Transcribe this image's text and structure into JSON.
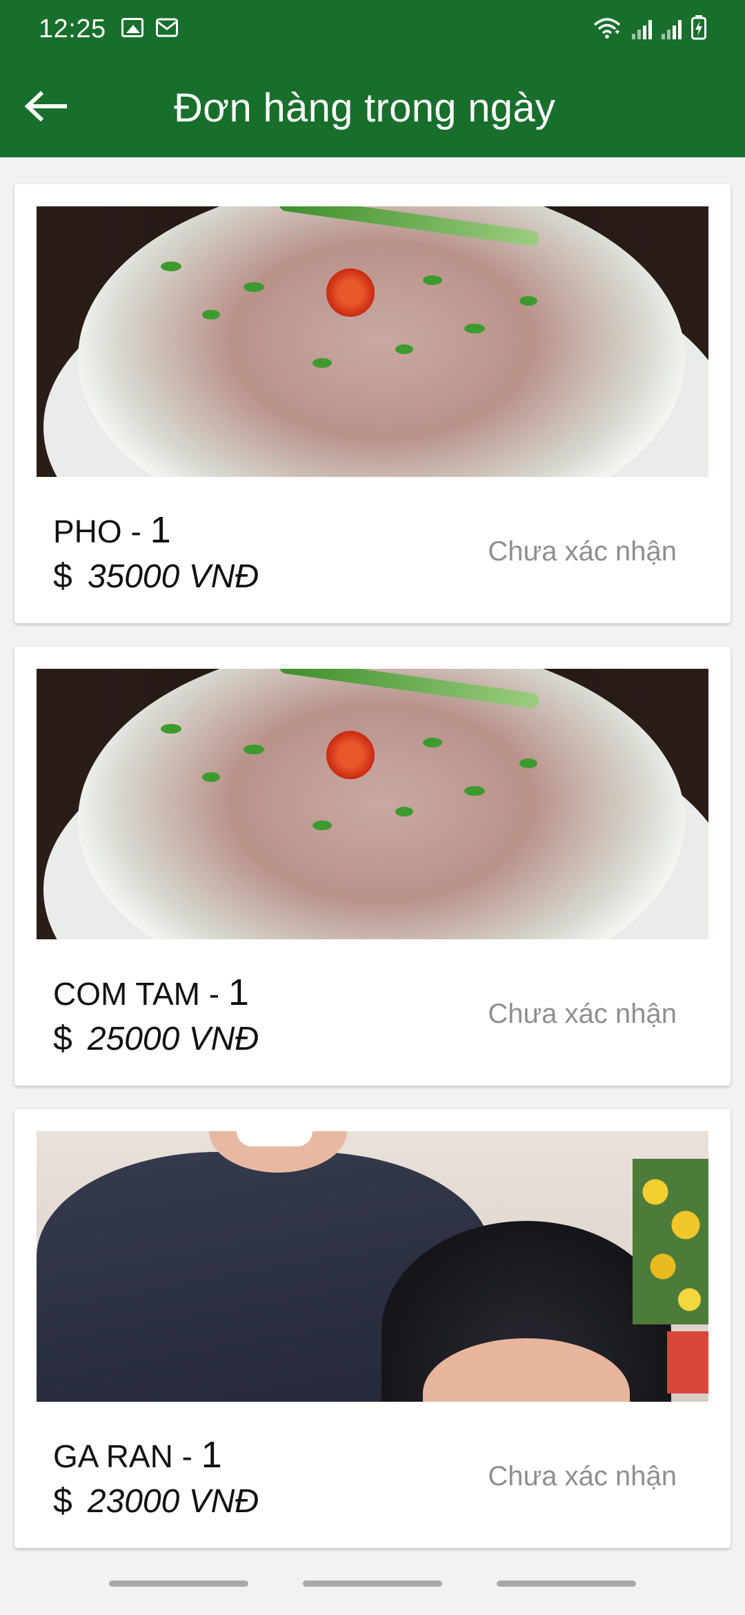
{
  "status_bar": {
    "time": "12:25",
    "left_icons": [
      "gallery-icon",
      "mail-icon"
    ],
    "right_icons": [
      "wifi-icon",
      "signal-icon",
      "signal-icon",
      "battery-icon"
    ]
  },
  "app_bar": {
    "title": "Đơn hàng trong ngày",
    "back_icon": "arrow-left-icon",
    "background": "#186f2c"
  },
  "orders": [
    {
      "name": "PHO",
      "separator": " - ",
      "quantity": "1",
      "currency": "$",
      "price": "35000 VNĐ",
      "status": "Chưa xác nhận",
      "image": "pho-bowl"
    },
    {
      "name": "COM TAM",
      "separator": " - ",
      "quantity": "1",
      "currency": "$",
      "price": "25000 VNĐ",
      "status": "Chưa xác nhận",
      "image": "pho-bowl"
    },
    {
      "name": "GA RAN",
      "separator": " - ",
      "quantity": "1",
      "currency": "$",
      "price": "23000 VNĐ",
      "status": "Chưa xác nhận",
      "image": "people-photo"
    }
  ],
  "colors": {
    "primary": "#186f2c",
    "status_text": "#8f8f8f",
    "card_bg": "#ffffff"
  }
}
